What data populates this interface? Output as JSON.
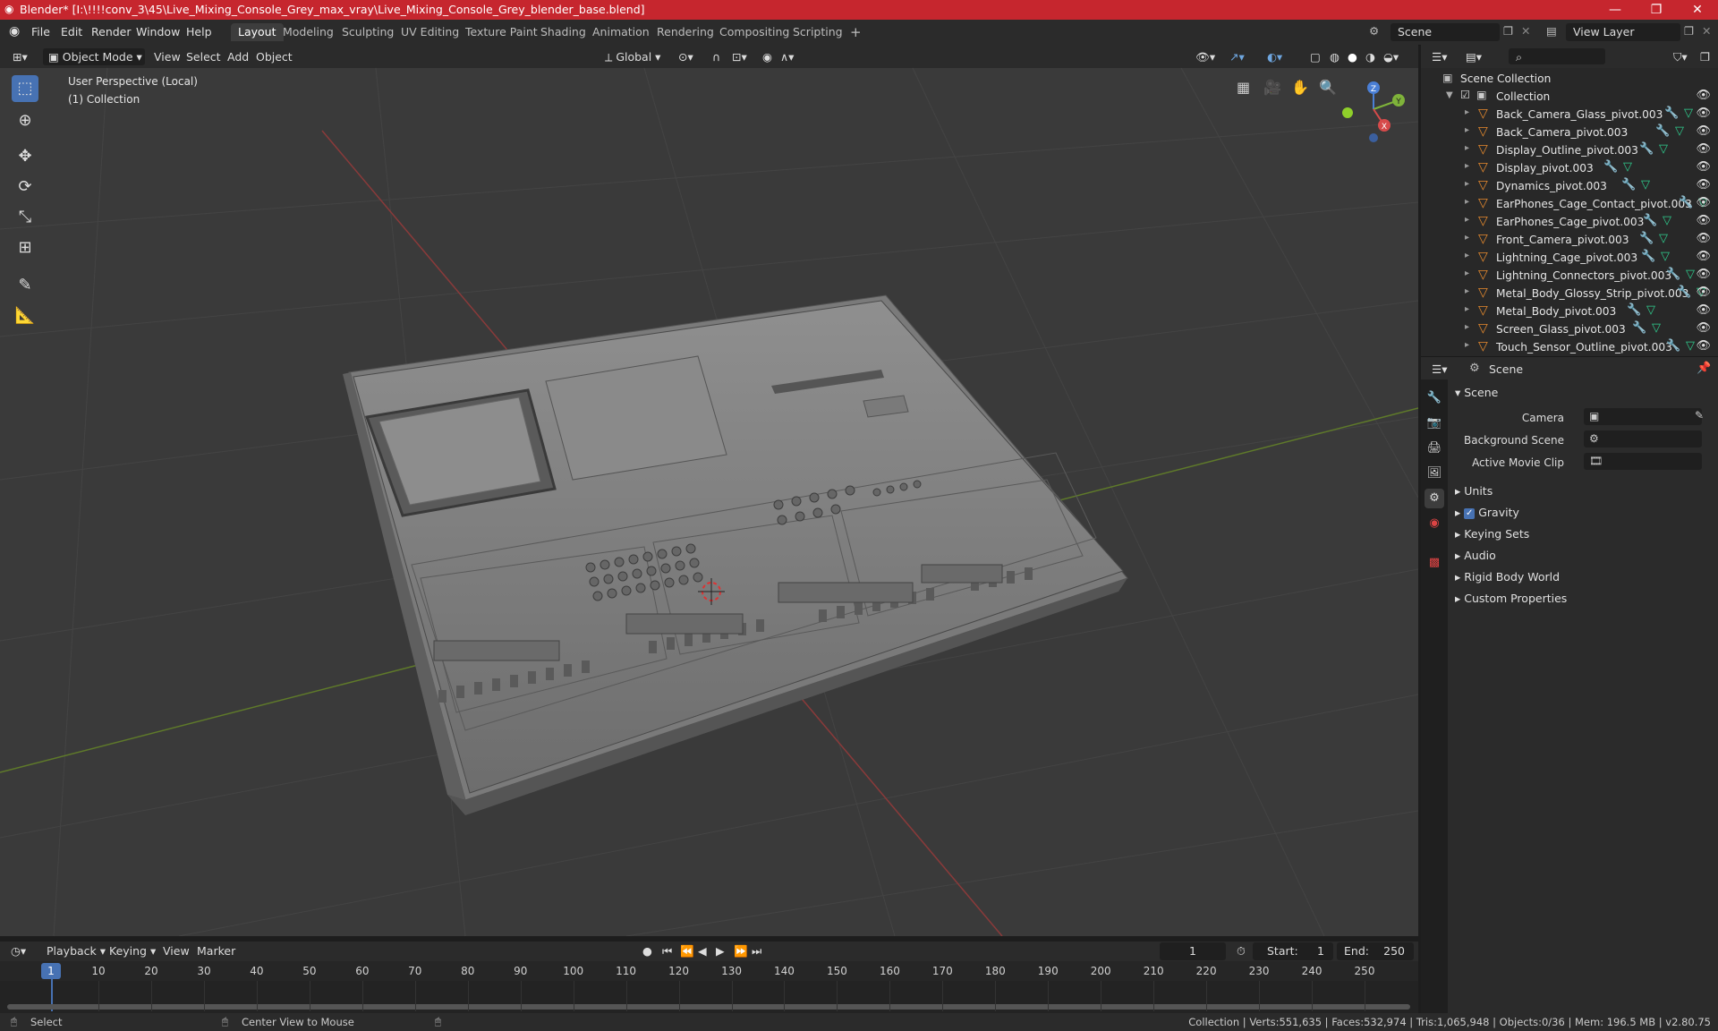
{
  "window": {
    "title": "Blender* [I:\\!!!!conv_3\\45\\Live_Mixing_Console_Grey_max_vray\\Live_Mixing_Console_Grey_blender_base.blend]",
    "minimize": "—",
    "maximize": "❐",
    "close": "✕"
  },
  "menu": {
    "items": [
      "File",
      "Edit",
      "Render",
      "Window",
      "Help"
    ],
    "workspaces": [
      "Layout",
      "Modeling",
      "Sculpting",
      "UV Editing",
      "Texture Paint",
      "Shading",
      "Animation",
      "Rendering",
      "Compositing",
      "Scripting"
    ],
    "active_workspace": "Layout",
    "add_tab": "+",
    "scene": "Scene",
    "view_layer": "View Layer"
  },
  "viewport_header": {
    "mode": "Object Mode",
    "menus": [
      "View",
      "Select",
      "Add",
      "Object"
    ],
    "transform_orientation": "Global"
  },
  "viewport": {
    "perspective_label": "User Perspective (Local)",
    "collection_label": "(1) Collection",
    "gizmo_axes": [
      "X",
      "Y",
      "Z"
    ]
  },
  "outliner": {
    "search_placeholder": "",
    "root": "Scene Collection",
    "collection": "Collection",
    "objects": [
      "Back_Camera_Glass_pivot.003",
      "Back_Camera_pivot.003",
      "Display_Outline_pivot.003",
      "Display_pivot.003",
      "Dynamics_pivot.003",
      "EarPhones_Cage_Contact_pivot.003",
      "EarPhones_Cage_pivot.003",
      "Front_Camera_pivot.003",
      "Lightning_Cage_pivot.003",
      "Lightning_Connectors_pivot.003",
      "Metal_Body_Glossy_Strip_pivot.003",
      "Metal_Body_pivot.003",
      "Screen_Glass_pivot.003",
      "Touch_Sensor_Outline_pivot.003"
    ]
  },
  "properties": {
    "context": "Scene",
    "panel_title": "Scene",
    "fields": [
      {
        "label": "Camera",
        "value": ""
      },
      {
        "label": "Background Scene",
        "value": ""
      },
      {
        "label": "Active Movie Clip",
        "value": ""
      }
    ],
    "sections": [
      "Units",
      "Gravity",
      "Keying Sets",
      "Audio",
      "Rigid Body World",
      "Custom Properties"
    ],
    "gravity_checked": true
  },
  "timeline": {
    "menus": [
      "Playback",
      "Keying",
      "View",
      "Marker"
    ],
    "current_frame": "1",
    "start_label": "Start:",
    "start": "1",
    "end_label": "End:",
    "end": "250",
    "ticks": [
      "1",
      "10",
      "20",
      "30",
      "40",
      "50",
      "60",
      "70",
      "80",
      "90",
      "100",
      "110",
      "120",
      "130",
      "140",
      "150",
      "160",
      "170",
      "180",
      "190",
      "200",
      "210",
      "220",
      "230",
      "240",
      "250"
    ]
  },
  "status": {
    "select": "Select",
    "center_view": "Center View to Mouse",
    "stats": "Collection | Verts:551,635 | Faces:532,974 | Tris:1,065,948 | Objects:0/36 | Mem: 196.5 MB | v2.80.75"
  },
  "colors": {
    "titlebar": "#c6262e",
    "accent": "#4772b3",
    "object_icon": "#e68a2e",
    "modifier_icon": "#6fa7e0",
    "mesh_icon": "#2fcf8f"
  }
}
